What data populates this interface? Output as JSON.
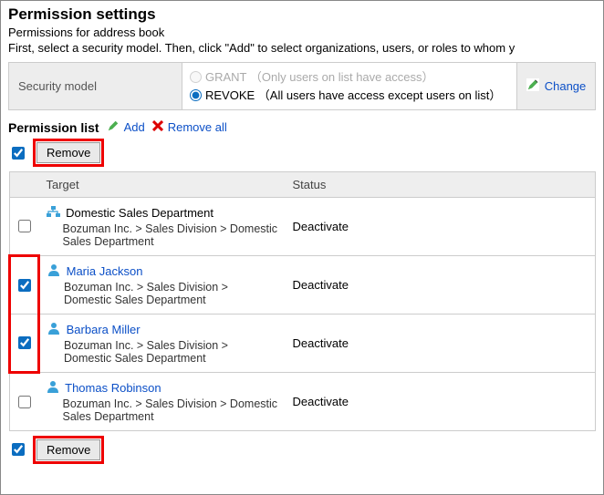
{
  "header": {
    "title": "Permission settings",
    "subtitle": "Permissions for address book",
    "instruction": "First, select a security model. Then, click \"Add\" to select organizations, users, or roles to whom y"
  },
  "security_model": {
    "label": "Security model",
    "grant": {
      "text": "GRANT （Only users on list have access）",
      "selected": false
    },
    "revoke": {
      "text": "REVOKE （All users have access except users on list）",
      "selected": true
    },
    "change_label": "Change"
  },
  "list": {
    "title": "Permission list",
    "add_label": "Add",
    "remove_all_label": "Remove all",
    "remove_label": "Remove",
    "columns": {
      "target": "Target",
      "status": "Status"
    },
    "rows": [
      {
        "type": "org",
        "name": "Domestic Sales Department",
        "path": "Bozuman Inc. > Sales Division > Domestic Sales Department",
        "status": "Deactivate",
        "checked": false
      },
      {
        "type": "user",
        "name": "Maria Jackson",
        "path": "Bozuman Inc. > Sales Division > Domestic Sales Department",
        "status": "Deactivate",
        "checked": true
      },
      {
        "type": "user",
        "name": "Barbara Miller",
        "path": "Bozuman Inc. > Sales Division > Domestic Sales Department",
        "status": "Deactivate",
        "checked": true
      },
      {
        "type": "user",
        "name": "Thomas Robinson",
        "path": "Bozuman Inc. > Sales Division > Domestic Sales Department",
        "status": "Deactivate",
        "checked": false
      }
    ]
  }
}
